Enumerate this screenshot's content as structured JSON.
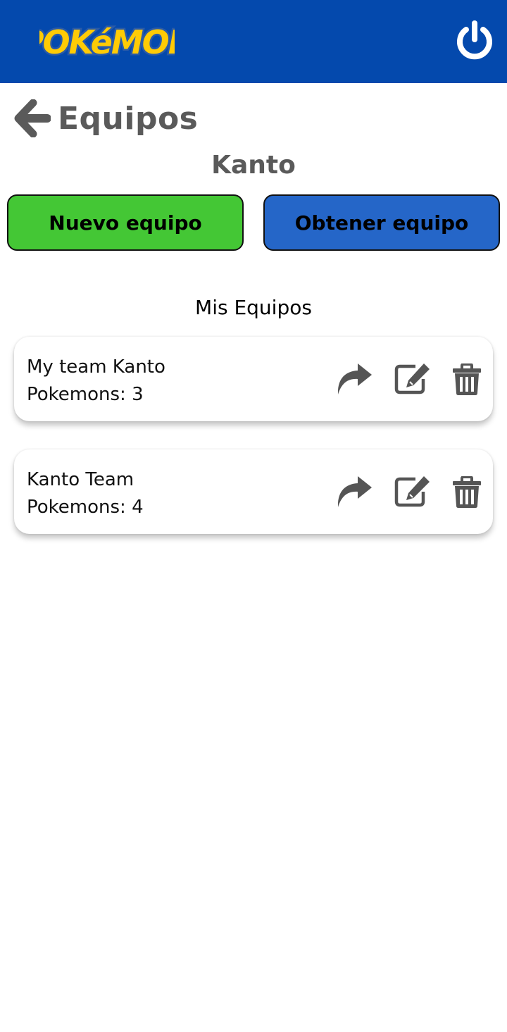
{
  "header": {
    "logo_text": "POKéMON",
    "brand_color": "#0449ad",
    "power_icon": "power-icon"
  },
  "nav": {
    "back_icon": "arrow-left-icon",
    "title": "Equipos"
  },
  "region": "Kanto",
  "buttons": {
    "new_team": "Nuevo equipo",
    "new_team_color": "#44c735",
    "get_team": "Obtener equipo",
    "get_team_color": "#2566c8"
  },
  "section_title": "Mis Equipos",
  "teams": [
    {
      "name": "My team Kanto",
      "count": "Pokemons: 3",
      "actions": [
        "share-icon",
        "edit-icon",
        "trash-icon"
      ]
    },
    {
      "name": "Kanto Team",
      "count": "Pokemons: 4",
      "actions": [
        "share-icon",
        "edit-icon",
        "trash-icon"
      ]
    }
  ]
}
